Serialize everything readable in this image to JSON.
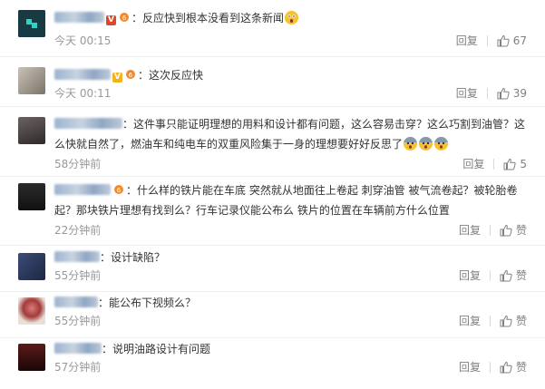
{
  "labels": {
    "reply": "回复",
    "like": "赞"
  },
  "comments": [
    {
      "text": "反应快到根本没看到这条新闻",
      "time": "今天 00:15",
      "likes": "67"
    },
    {
      "text": "这次反应快",
      "time": "今天 00:11",
      "likes": "39"
    },
    {
      "text": "这件事只能证明理想的用料和设计都有问题，这么容易击穿？这么巧割到油管？这么快就自然了，燃油车和纯电车的双重风险集于一身的理想要好好反思了",
      "time": "58分钟前",
      "likes": "5"
    },
    {
      "text": "什么样的铁片能在车底 突然就从地面往上卷起 刺穿油管 被气流卷起？被轮胎卷起？那块铁片理想有找到么？行车记录仪能公布么 铁片的位置在车辆前方什么位置",
      "time": "22分钟前",
      "likes": "赞"
    },
    {
      "text": "设计缺陷？",
      "time": "55分钟前",
      "likes": "赞"
    },
    {
      "text": "能公布下视频么？",
      "time": "55分钟前",
      "likes": "赞"
    },
    {
      "text": "说明油路设计有问题",
      "time": "57分钟前",
      "likes": "赞"
    }
  ]
}
